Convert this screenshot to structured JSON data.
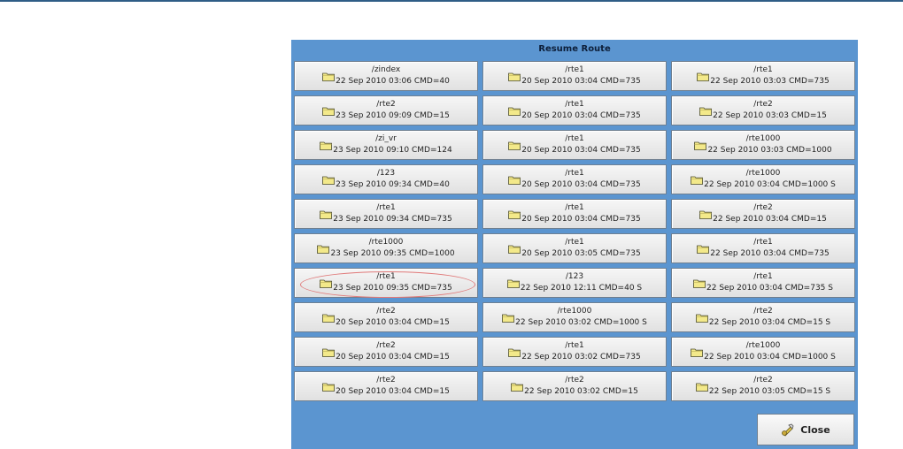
{
  "dialog": {
    "title": "Resume Route",
    "close_label": "Close"
  },
  "routes": [
    {
      "name": "/zindex",
      "info": "22 Sep 2010 03:06 CMD=40"
    },
    {
      "name": "/rte1",
      "info": "20 Sep 2010 03:04 CMD=735"
    },
    {
      "name": "/rte1",
      "info": "22 Sep 2010 03:03 CMD=735"
    },
    {
      "name": "/rte2",
      "info": "23 Sep 2010 09:09 CMD=15"
    },
    {
      "name": "/rte1",
      "info": "20 Sep 2010 03:04 CMD=735"
    },
    {
      "name": "/rte2",
      "info": "22 Sep 2010 03:03 CMD=15"
    },
    {
      "name": "/zi_vr",
      "info": "23 Sep 2010 09:10 CMD=124"
    },
    {
      "name": "/rte1",
      "info": "20 Sep 2010 03:04 CMD=735"
    },
    {
      "name": "/rte1000",
      "info": "22 Sep 2010 03:03 CMD=1000"
    },
    {
      "name": "/123",
      "info": "23 Sep 2010 09:34 CMD=40"
    },
    {
      "name": "/rte1",
      "info": "20 Sep 2010 03:04 CMD=735"
    },
    {
      "name": "/rte1000",
      "info": "22 Sep 2010 03:04 CMD=1000 S"
    },
    {
      "name": "/rte1",
      "info": "23 Sep 2010 09:34 CMD=735"
    },
    {
      "name": "/rte1",
      "info": "20 Sep 2010 03:04 CMD=735"
    },
    {
      "name": "/rte2",
      "info": "22 Sep 2010 03:04 CMD=15"
    },
    {
      "name": "/rte1000",
      "info": "23 Sep 2010 09:35 CMD=1000"
    },
    {
      "name": "/rte1",
      "info": "20 Sep 2010 03:05 CMD=735"
    },
    {
      "name": "/rte1",
      "info": "22 Sep 2010 03:04 CMD=735"
    },
    {
      "name": "/rte1",
      "info": "23 Sep 2010 09:35 CMD=735"
    },
    {
      "name": "/123",
      "info": "22 Sep 2010 12:11 CMD=40  S"
    },
    {
      "name": "/rte1",
      "info": "22 Sep 2010 03:04 CMD=735  S"
    },
    {
      "name": "/rte2",
      "info": "20 Sep 2010 03:04 CMD=15"
    },
    {
      "name": "/rte1000",
      "info": "22 Sep 2010 03:02 CMD=1000  S"
    },
    {
      "name": "/rte2",
      "info": "22 Sep 2010 03:04 CMD=15  S"
    },
    {
      "name": "/rte2",
      "info": "20 Sep 2010 03:04 CMD=15"
    },
    {
      "name": "/rte1",
      "info": "22 Sep 2010 03:02 CMD=735"
    },
    {
      "name": "/rte1000",
      "info": "22 Sep 2010 03:04 CMD=1000  S"
    },
    {
      "name": "/rte2",
      "info": "20 Sep 2010 03:04 CMD=15"
    },
    {
      "name": "/rte2",
      "info": "22 Sep 2010 03:02 CMD=15"
    },
    {
      "name": "/rte2",
      "info": "22 Sep 2010 03:05 CMD=15  S"
    }
  ],
  "highlighted_route_index": 18,
  "icons": {
    "route_item": "folder-icon",
    "close": "close-icon"
  },
  "colors": {
    "dialog_background": "#5b95d0",
    "folder_fill": "#f3e98a",
    "highlight_outline": "#e07a7a"
  }
}
